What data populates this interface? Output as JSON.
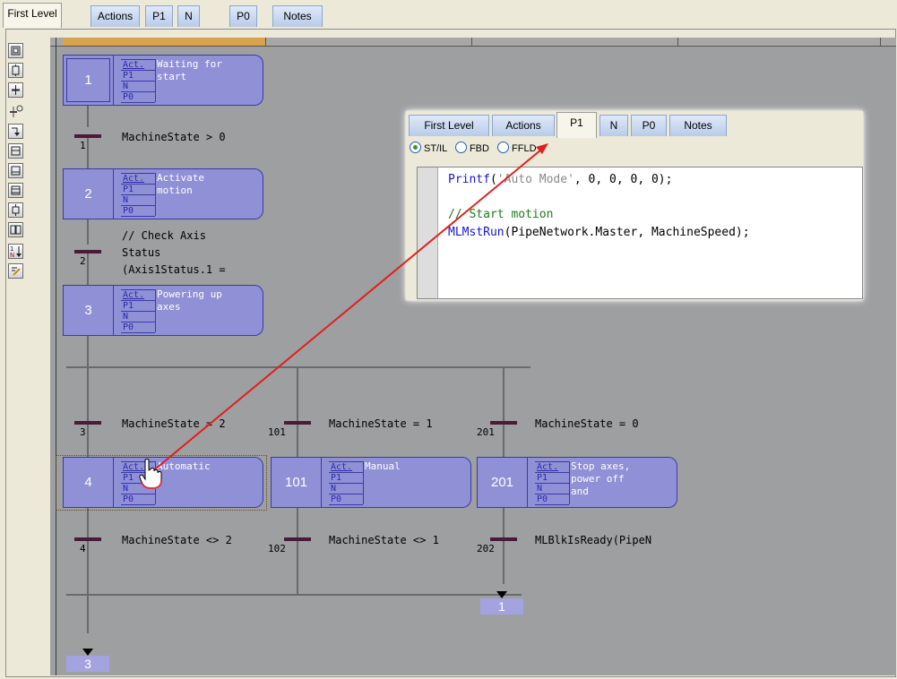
{
  "main_tabs": [
    {
      "label": "First Level",
      "active": true
    },
    {
      "label": "Actions",
      "active": false
    },
    {
      "label": "P1",
      "active": false
    },
    {
      "label": "N",
      "active": false
    },
    {
      "label": "P0",
      "active": false
    },
    {
      "label": "Notes",
      "active": false
    }
  ],
  "toolbar_icons": [
    "initial-step-icon",
    "step-icon",
    "add-transition-icon",
    "add-macro-icon",
    "jump-icon",
    "divergence-icon",
    "convergence-icon",
    "simultaneous-icon",
    "insert-step-icon",
    "align-icon",
    "sort-icon",
    "edit-action-icon"
  ],
  "qualifiers": [
    "Act.",
    "P1",
    "N",
    "P0"
  ],
  "steps": [
    {
      "number": "1",
      "label": "Waiting for\nstart",
      "initial": true
    },
    {
      "number": "2",
      "label": "Activate\nmotion"
    },
    {
      "number": "3",
      "label": "Powering up\naxes"
    },
    {
      "number": "4",
      "label": "Automatic"
    },
    {
      "number": "101",
      "label": "Manual"
    },
    {
      "number": "201",
      "label": "Stop axes,\npower off\nand"
    }
  ],
  "transitions": [
    {
      "number": "1",
      "condition": "MachineState > 0"
    },
    {
      "number": "2",
      "condition": "// Check Axis\nStatus\n(Axis1Status.1 ="
    },
    {
      "number": "3",
      "condition": "MachineState = 2"
    },
    {
      "number": "101",
      "condition": "MachineState = 1"
    },
    {
      "number": "201",
      "condition": "MachineState = 0"
    },
    {
      "number": "4",
      "condition": "MachineState <> 2"
    },
    {
      "number": "102",
      "condition": "MachineState <> 1"
    },
    {
      "number": "202",
      "condition": "MLBlkIsReady(PipeN"
    }
  ],
  "jumps": [
    {
      "target": "1"
    },
    {
      "target": "3"
    }
  ],
  "popup": {
    "tabs": [
      {
        "label": "First Level",
        "active": false
      },
      {
        "label": "Actions",
        "active": false
      },
      {
        "label": "P1",
        "active": true
      },
      {
        "label": "N",
        "active": false
      },
      {
        "label": "P0",
        "active": false
      },
      {
        "label": "Notes",
        "active": false
      }
    ],
    "languages": [
      {
        "label": "ST/IL",
        "selected": true
      },
      {
        "label": "FBD",
        "selected": false
      },
      {
        "label": "FFLD",
        "selected": false
      }
    ],
    "code": {
      "line1_fn": "Printf",
      "line1_rest": "(",
      "line1_str": "'Auto Mode'",
      "line1_tail": ", 0, 0, 0, 0);",
      "line2": "",
      "line3_comment": "// Start motion",
      "line4_fn": "MLMstRun",
      "line4_rest": "(PipeNetwork.Master, MachineSpeed);"
    }
  },
  "colors": {
    "step_fill": "#9090d6",
    "canvas_bg": "#9e9fa0",
    "arrow": "#e02020",
    "transition_bar": "#4b1a3a"
  }
}
